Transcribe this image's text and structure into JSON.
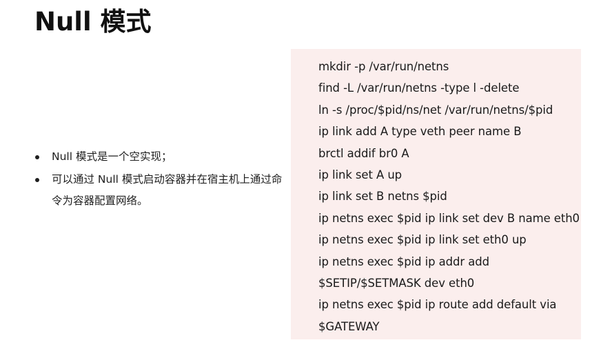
{
  "title": "Null 模式",
  "bullets": [
    "Null  模式是一个空实现；",
    "可以通过 Null 模式启动容器并在宿主机上通过命令为容器配置网络。"
  ],
  "code_lines": [
    "mkdir -p /var/run/netns",
    "find -L /var/run/netns -type l -delete",
    "ln -s /proc/$pid/ns/net /var/run/netns/$pid",
    "ip link add A type veth peer name B",
    "brctl addif br0 A",
    "ip link set A up",
    "ip link set B netns $pid",
    "ip netns exec $pid ip link set dev B name eth0",
    "ip netns exec $pid ip link set eth0 up",
    "ip netns exec $pid ip addr add",
    "$SETIP/$SETMASK dev eth0",
    "ip netns exec $pid ip route add default via",
    "$GATEWAY"
  ],
  "colors": {
    "code_background": "#fbeeed",
    "text": "#1a1a1a"
  }
}
